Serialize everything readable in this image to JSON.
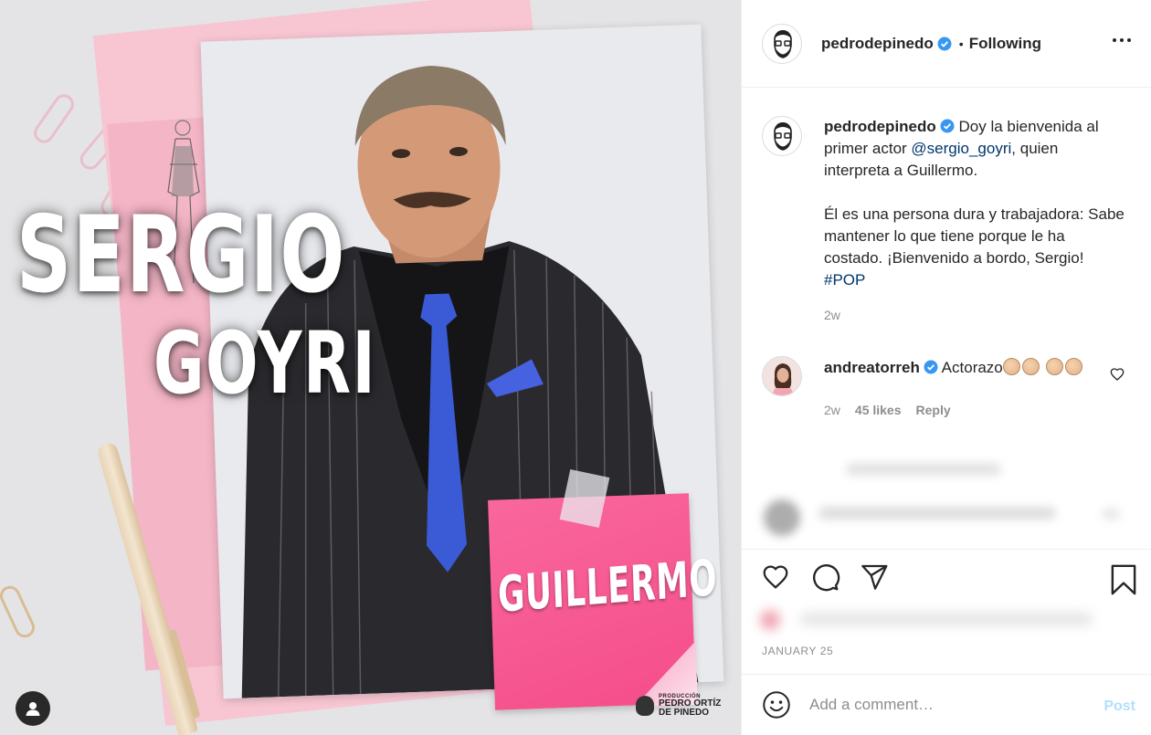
{
  "media": {
    "title_first": "SERGIO",
    "title_last": "GOYRI",
    "character_name": "GUILLERMO",
    "producer": {
      "small": "PRODUCCIÓN",
      "line1": "PEDRO ORTÍZ",
      "line2": "DE PINEDO"
    },
    "user_tag_icon": "user-tag-icon"
  },
  "header": {
    "username": "pedrodepinedo",
    "verified": true,
    "separator": "•",
    "follow_status": "Following",
    "more_icon": "more-options-icon"
  },
  "caption": {
    "username": "pedrodepinedo",
    "text_before_mention": "Doy la bienvenida al primer actor ",
    "mention": "@sergio_goyri",
    "text_after_mention": ", quien interpreta a Guillermo.",
    "paragraph2": "Él es una persona dura y trabajadora: Sabe mantener lo que tiene porque le ha costado. ¡Bienvenido a bordo, Sergio! ",
    "hashtag": "#POP",
    "time": "2w"
  },
  "comments": [
    {
      "username": "andreatorreh",
      "verified": true,
      "text": "Actorazo",
      "emoji_count": 4,
      "time": "2w",
      "likes": "45 likes",
      "reply_label": "Reply"
    }
  ],
  "actions": {
    "like_icon": "heart-icon",
    "comment_icon": "comment-icon",
    "share_icon": "share-icon",
    "save_icon": "bookmark-icon"
  },
  "post_date": "JANUARY 25",
  "add_comment": {
    "placeholder": "Add a comment…",
    "post_label": "Post",
    "emoji_icon": "smiley-icon"
  },
  "colors": {
    "verified_blue": "#3897f0",
    "link": "#00376b",
    "muted": "#8e8e8e",
    "post_disabled": "#b2dffc",
    "sticky_pink": "#f7609a"
  }
}
